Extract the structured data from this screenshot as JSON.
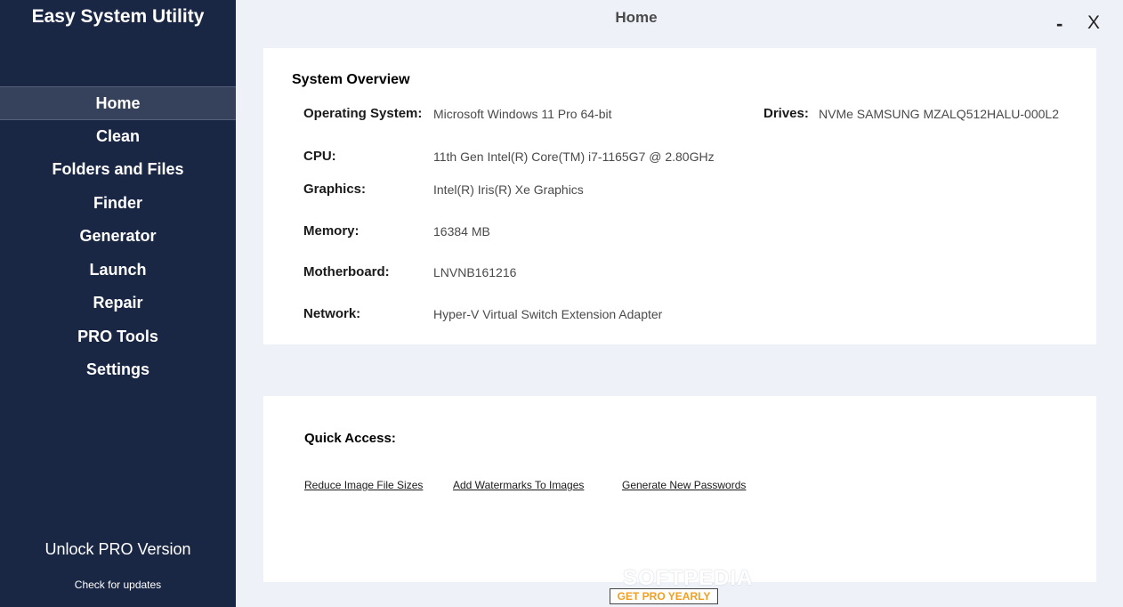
{
  "app": {
    "title": "Easy System Utility"
  },
  "sidebar": {
    "items": [
      {
        "label": "Home"
      },
      {
        "label": "Clean"
      },
      {
        "label": "Folders and Files"
      },
      {
        "label": "Finder"
      },
      {
        "label": "Generator"
      },
      {
        "label": "Launch"
      },
      {
        "label": "Repair"
      },
      {
        "label": "PRO Tools"
      },
      {
        "label": "Settings"
      }
    ],
    "active": "Home",
    "unlock_label": "Unlock PRO Version",
    "updates_label": "Check for updates"
  },
  "header": {
    "title": "Home",
    "minimize_label": "-",
    "close_label": "X"
  },
  "overview": {
    "title": "System Overview",
    "os_label": "Operating System:",
    "os_value": "Microsoft Windows 11 Pro 64-bit",
    "drives_label": "Drives:",
    "drives_value": "NVMe SAMSUNG MZALQ512HALU-000L2",
    "cpu_label": "CPU:",
    "cpu_value": "11th Gen Intel(R) Core(TM) i7-1165G7 @ 2.80GHz",
    "graphics_label": "Graphics:",
    "graphics_value": "Intel(R) Iris(R) Xe Graphics",
    "memory_label": "Memory:",
    "memory_value": "16384 MB",
    "motherboard_label": "Motherboard:",
    "motherboard_value": "LNVNB161216",
    "network_label": "Network:",
    "network_value": "Hyper-V Virtual Switch Extension Adapter"
  },
  "quick_access": {
    "title": "Quick Access:",
    "links": [
      {
        "label": "Reduce Image File Sizes"
      },
      {
        "label": "Add Watermarks To Images"
      },
      {
        "label": "Generate New Passwords"
      }
    ]
  },
  "footer": {
    "pro_button_label": "GET PRO YEARLY",
    "watermark": "SOFTPEDIA"
  },
  "colors": {
    "sidebar_bg": "#1a2744",
    "accent": "#f0a020",
    "page_bg": "#eef2f8"
  }
}
